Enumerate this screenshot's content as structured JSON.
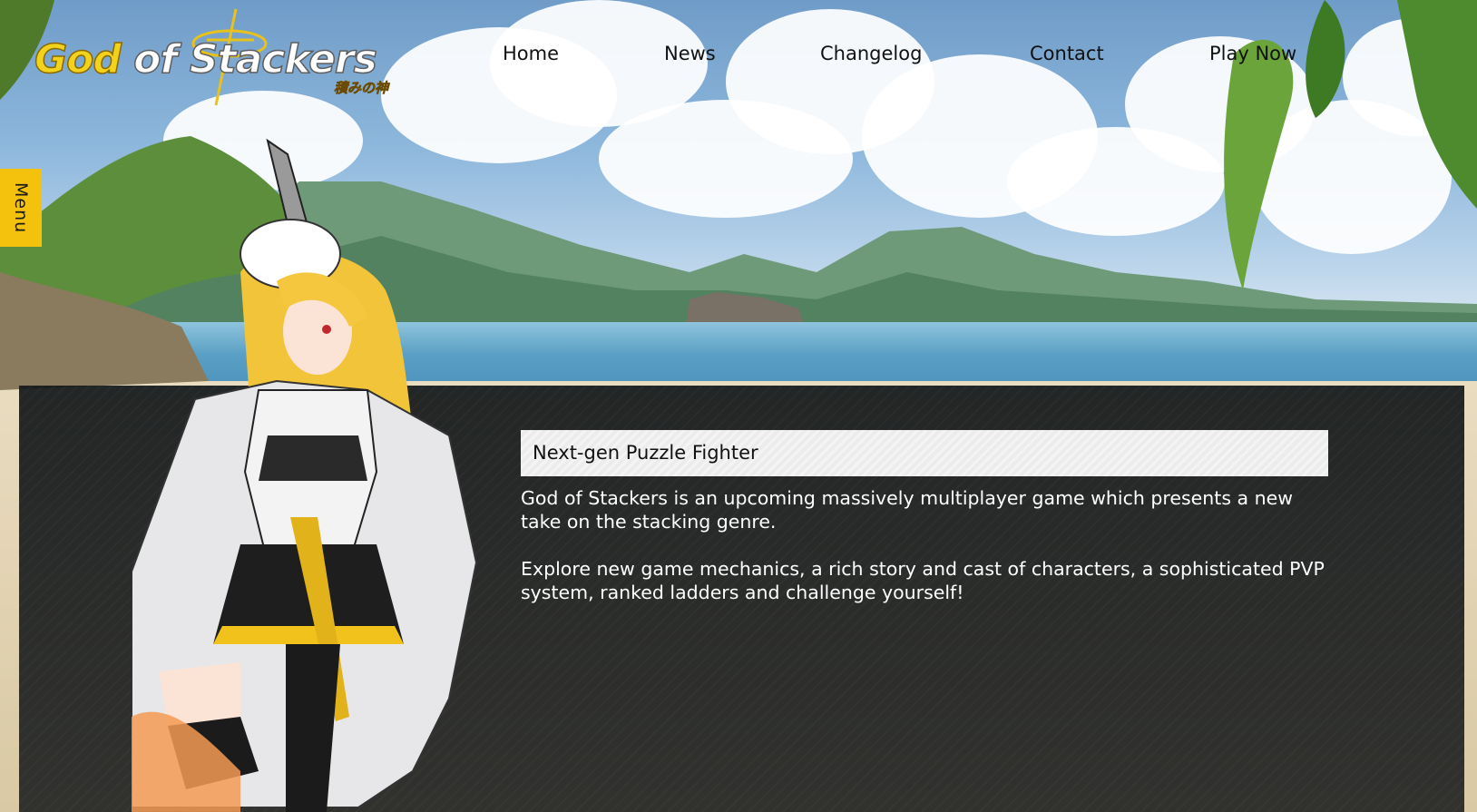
{
  "logo": {
    "part_god": "God",
    "part_of": "of",
    "part_stackers": "Stackers",
    "subtitle": "積みの神"
  },
  "nav": {
    "items": [
      {
        "label": "Home"
      },
      {
        "label": "News"
      },
      {
        "label": "Changelog"
      },
      {
        "label": "Contact"
      },
      {
        "label": "Play Now"
      }
    ]
  },
  "side_menu": {
    "label": "Menu"
  },
  "main": {
    "heading": "Next-gen Puzzle Fighter",
    "paragraphs": [
      "God of Stackers is an upcoming massively multiplayer game which presents a new take on the stacking genre.",
      "Explore new game mechanics, a rich story and cast of characters, a sophisticated PVP system, ranked ladders and challenge yourself!"
    ]
  },
  "colors": {
    "accent_yellow": "#f4c20d",
    "panel_dark": "#181c1e",
    "heading_bg": "#f2f2f2",
    "text_light": "#ffffff"
  },
  "icons": {
    "logo_emblem": "golden-cross-ring-icon",
    "hero_art": "anime-character-illustration"
  }
}
